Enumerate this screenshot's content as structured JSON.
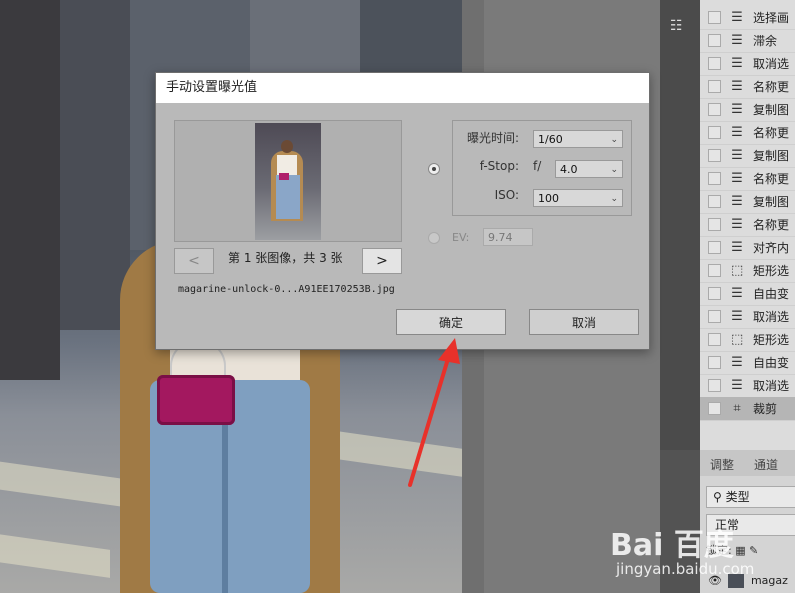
{
  "dialog": {
    "title": "手动设置曝光值",
    "image_counter": "第 1 张图像，共 3 张",
    "prev_label": "<",
    "next_label": ">",
    "filename": "magarine-unlock-0...A91EE170253B.jpg",
    "exposure_time_label": "曝光时间:",
    "exposure_time_value": "1/60",
    "fstop_label": "f-Stop:",
    "fstop_prefix": "f/",
    "fstop_value": "4.0",
    "iso_label": "ISO:",
    "iso_value": "100",
    "ev_label": "EV:",
    "ev_value": "9.74",
    "ok_label": "确定",
    "cancel_label": "取消"
  },
  "history": {
    "items": [
      {
        "label": "选择画",
        "icon": "doc-icon"
      },
      {
        "label": "滞余",
        "icon": "doc-icon"
      },
      {
        "label": "取消选",
        "icon": "doc-icon"
      },
      {
        "label": "名称更",
        "icon": "doc-icon"
      },
      {
        "label": "复制图",
        "icon": "doc-icon"
      },
      {
        "label": "名称更",
        "icon": "doc-icon"
      },
      {
        "label": "复制图",
        "icon": "doc-icon"
      },
      {
        "label": "名称更",
        "icon": "doc-icon"
      },
      {
        "label": "复制图",
        "icon": "doc-icon"
      },
      {
        "label": "名称更",
        "icon": "doc-icon"
      },
      {
        "label": "对齐内",
        "icon": "doc-icon"
      },
      {
        "label": "矩形选",
        "icon": "marquee-icon"
      },
      {
        "label": "自由变",
        "icon": "doc-icon"
      },
      {
        "label": "取消选",
        "icon": "doc-icon"
      },
      {
        "label": "矩形选",
        "icon": "marquee-icon"
      },
      {
        "label": "自由变",
        "icon": "doc-icon"
      },
      {
        "label": "取消选",
        "icon": "doc-icon"
      },
      {
        "label": "裁剪",
        "icon": "crop-icon"
      }
    ]
  },
  "panel": {
    "tab_adjust": "调整",
    "tab_channels": "通道",
    "filter_kind": "类型",
    "blend_mode": "正常",
    "lock_label": "锁定:",
    "layer_name": "magaz"
  },
  "watermark": {
    "main": "Bai 百度",
    "sub": "jingyan.baidu.com"
  },
  "colors": {
    "dialog_bg": "#b9b9b9",
    "arrow": "#e8312a",
    "bag": "#a3185f"
  }
}
